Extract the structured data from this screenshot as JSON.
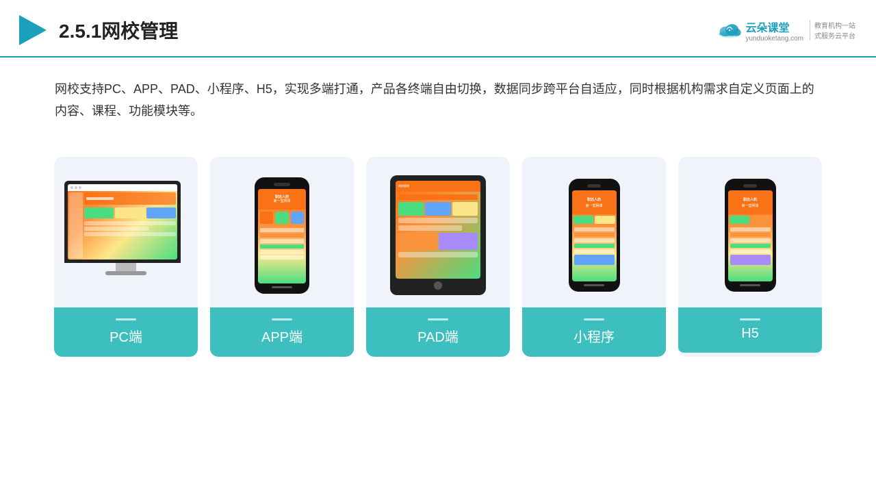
{
  "header": {
    "title": "2.5.1网校管理",
    "logo": {
      "name": "云朵课堂",
      "url": "yunduoketang.com",
      "tagline1": "教育机构一站",
      "tagline2": "式服务云平台"
    }
  },
  "description": {
    "text": "网校支持PC、APP、PAD、小程序、H5，实现多端打通，产品各终端自由切换，数据同步跨平台自适应，同时根据机构需求自定义页面上的内容、课程、功能模块等。"
  },
  "cards": [
    {
      "id": "pc",
      "label": "PC端"
    },
    {
      "id": "app",
      "label": "APP端"
    },
    {
      "id": "pad",
      "label": "PAD端"
    },
    {
      "id": "mini",
      "label": "小程序"
    },
    {
      "id": "h5",
      "label": "H5"
    }
  ],
  "accent_color": "#3dbfbf",
  "brand_color": "#1a9fbd"
}
